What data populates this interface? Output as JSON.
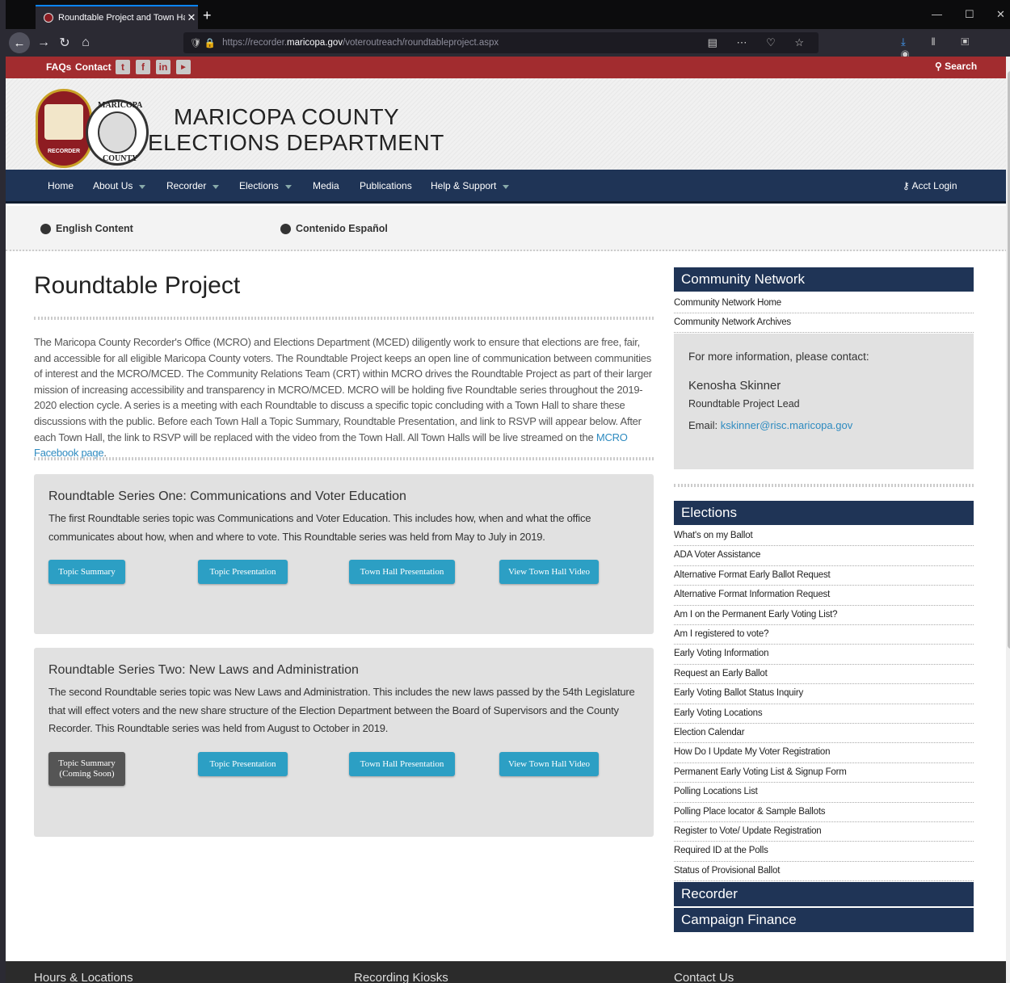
{
  "browser": {
    "tab_title": "Roundtable Project and Town Hall",
    "url_prefix": "https://recorder.",
    "url_domain": "maricopa.gov",
    "url_path": "/voteroutreach/roundtableproject.aspx"
  },
  "topbar": {
    "faqs": "FAQs",
    "contact": "Contact",
    "search": "Search"
  },
  "header": {
    "title_line1": "MARICOPA COUNTY",
    "title_line2": "ELECTIONS DEPARTMENT",
    "seal1_label": "RECORDER",
    "seal2_top": "MARICOPA",
    "seal2_bottom": "COUNTY"
  },
  "nav": {
    "items": [
      {
        "label": "Home",
        "dropdown": false
      },
      {
        "label": "About Us",
        "dropdown": true
      },
      {
        "label": "Recorder",
        "dropdown": true
      },
      {
        "label": "Elections",
        "dropdown": true
      },
      {
        "label": "Media",
        "dropdown": false
      },
      {
        "label": "Publications",
        "dropdown": false
      },
      {
        "label": "Help & Support",
        "dropdown": true
      }
    ],
    "acct_login": "Acct Login"
  },
  "lang": {
    "english": "English Content",
    "spanish": "Contenido Español"
  },
  "page": {
    "title": "Roundtable Project",
    "intro": "The Maricopa County Recorder's Office (MCRO) and Elections Department (MCED) diligently work to ensure that elections are free, fair, and accessible for all eligible Maricopa County voters. The Roundtable Project keeps an open line of communication between communities of interest and the MCRO/MCED. The Community Relations Team (CRT) within MCRO drives the Roundtable Project as part of their larger mission of increasing accessibility and transparency in MCRO/MCED. MCRO will be holding five Roundtable series throughout the 2019-2020 election cycle. A series is a meeting with each Roundtable to discuss a specific topic concluding with a Town Hall to share these discussions with the public. Before each Town Hall a Topic Summary, Roundtable Presentation, and link to RSVP will appear below. After each Town Hall, the link to RSVP will be replaced with the video from the Town Hall. All Town Halls will be live streamed on the ",
    "intro_link": "MCRO Facebook page",
    "intro_end": "."
  },
  "series": [
    {
      "heading": "Roundtable Series One: Communications and Voter Education",
      "text": "The first Roundtable series topic was Communications and Voter Education. This includes how, when and what the office communicates about how, when and where to vote. This Roundtable series was held from May to July in 2019.",
      "buttons": [
        "Topic Summary",
        "Topic Presentation",
        "Town Hall Presentation",
        "View Town Hall Video"
      ]
    },
    {
      "heading": "Roundtable Series Two: New Laws and Administration",
      "text": "The second Roundtable series topic was New Laws and Administration. This includes the new laws passed by the 54th Legislature that will effect voters and the new share structure of the Election Department between the Board of Supervisors and the County Recorder. This Roundtable series was held from August to October in 2019.",
      "buttons": [
        "Topic Summary",
        "(Coming Soon)",
        "Topic Presentation",
        "Town Hall Presentation",
        "View Town Hall Video"
      ]
    }
  ],
  "sidebar": {
    "community_heading": "Community Network",
    "community_links": [
      "Community Network Home",
      "Community Network Archives"
    ],
    "contact_intro": "For more information, please contact:",
    "contact_name": "Kenosha Skinner",
    "contact_role": "Roundtable Project Lead",
    "contact_email_label": "Email: ",
    "contact_email": "kskinner@risc.maricopa.gov",
    "elections_heading": "Elections",
    "elections_links": [
      "What's on my Ballot",
      "ADA Voter Assistance",
      "Alternative Format Early Ballot Request",
      "Alternative Format Information Request",
      "Am I on the Permanent Early Voting List?",
      "Am I registered to vote?",
      "Early Voting Information",
      "Request an Early Ballot",
      "Early Voting Ballot Status Inquiry",
      "Early Voting Locations",
      "Election Calendar",
      "How Do I Update My Voter Registration",
      "Permanent Early Voting List & Signup Form",
      "Polling Locations List",
      "Polling Place locator & Sample Ballots",
      "Register to Vote/ Update Registration",
      "Required ID at the Polls",
      "Status of Provisional Ballot"
    ],
    "recorder_heading": "Recorder",
    "campaign_heading": "Campaign Finance"
  },
  "footer": {
    "col1": "Hours & Locations",
    "col2": "Recording Kiosks",
    "col3": "Contact Us"
  }
}
